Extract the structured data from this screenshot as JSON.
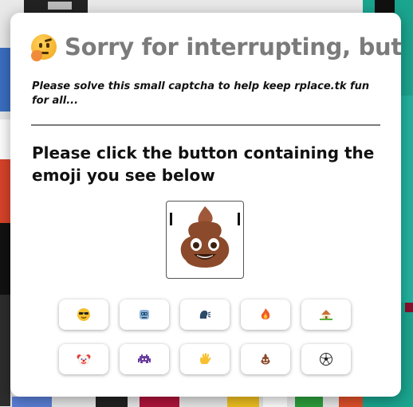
{
  "dialog": {
    "title_emoji": "thinking-face-emoji",
    "title": "Sorry for interrupting, but",
    "subtitle": "Please solve this small captcha to help keep rplace.tk fun for all...",
    "prompt": "Please click the button containing the emoji you see below",
    "target_emoji": "pile-of-poo"
  },
  "options": [
    {
      "emoji": "smiling-face-with-sunglasses"
    },
    {
      "emoji": "robot-face"
    },
    {
      "emoji": "speaking-head"
    },
    {
      "emoji": "fire"
    },
    {
      "emoji": "house-with-garden"
    },
    {
      "emoji": "clown-face"
    },
    {
      "emoji": "alien-monster"
    },
    {
      "emoji": "waving-hand"
    },
    {
      "emoji": "pile-of-poo"
    },
    {
      "emoji": "soccer-ball"
    }
  ],
  "colors": {
    "title": "#7b7b7b",
    "modal_bg": "#ffffff",
    "divider": "#7a7a7a"
  }
}
